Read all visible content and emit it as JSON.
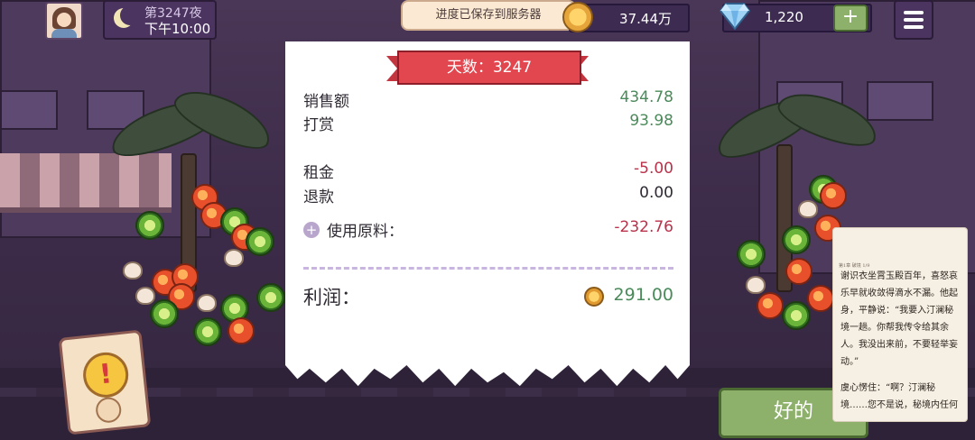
{
  "hud": {
    "day_label": "第3247夜",
    "time_label": "下午10:00",
    "save_toast": "进度已保存到服务器",
    "coins": "37.44万",
    "gems": "1,220",
    "add_gems_label": "+"
  },
  "receipt": {
    "day_banner": "天数：3247",
    "sales_label": "销售额",
    "sales_value": "434.78",
    "tips_label": "打赏",
    "tips_value": "93.98",
    "rent_label": "租金",
    "rent_value": "-5.00",
    "refund_label": "退款",
    "refund_value": "0.00",
    "ingredients_label": "使用原料：",
    "ingredients_value": "-232.76",
    "profit_label": "利润：",
    "profit_value": "291.00"
  },
  "ok_button_label": "好的",
  "reader": {
    "header": "第1章  破境  1/9",
    "para1": "谢识衣坐霄玉殿百年，喜怒哀乐早就收敛得滴水不漏。他起身，平静说：“我要入汀澜秘境一趟。你帮我传令给其余人。我没出来前，不要轻举妄动。”",
    "para2": "虞心愣住：“啊？汀澜秘境……您不是说，秘境内任何"
  },
  "colors": {
    "positive": "#4b8a5a",
    "negative": "#b8324b",
    "banner": "#e2474f",
    "ok_button": "#8db06a"
  }
}
